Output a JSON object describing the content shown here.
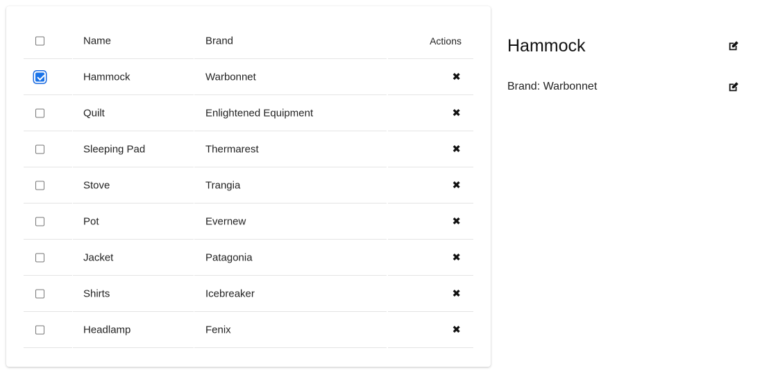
{
  "table": {
    "columns": {
      "name": "Name",
      "brand": "Brand",
      "actions": "Actions"
    },
    "rows": [
      {
        "name": "Hammock",
        "brand": "Warbonnet",
        "checked": true
      },
      {
        "name": "Quilt",
        "brand": "Enlightened Equipment",
        "checked": false
      },
      {
        "name": "Sleeping Pad",
        "brand": "Thermarest",
        "checked": false
      },
      {
        "name": "Stove",
        "brand": "Trangia",
        "checked": false
      },
      {
        "name": "Pot",
        "brand": "Evernew",
        "checked": false
      },
      {
        "name": "Jacket",
        "brand": "Patagonia",
        "checked": false
      },
      {
        "name": "Shirts",
        "brand": "Icebreaker",
        "checked": false
      },
      {
        "name": "Headlamp",
        "brand": "Fenix",
        "checked": false
      }
    ],
    "delete_glyph": "✖"
  },
  "detail": {
    "title": "Hammock",
    "brand_line": "Brand: Warbonnet"
  },
  "colors": {
    "accent": "#1a73e8",
    "divider": "#e4e4e4"
  },
  "icons": {
    "delete": "x-icon",
    "edit": "edit-icon"
  }
}
